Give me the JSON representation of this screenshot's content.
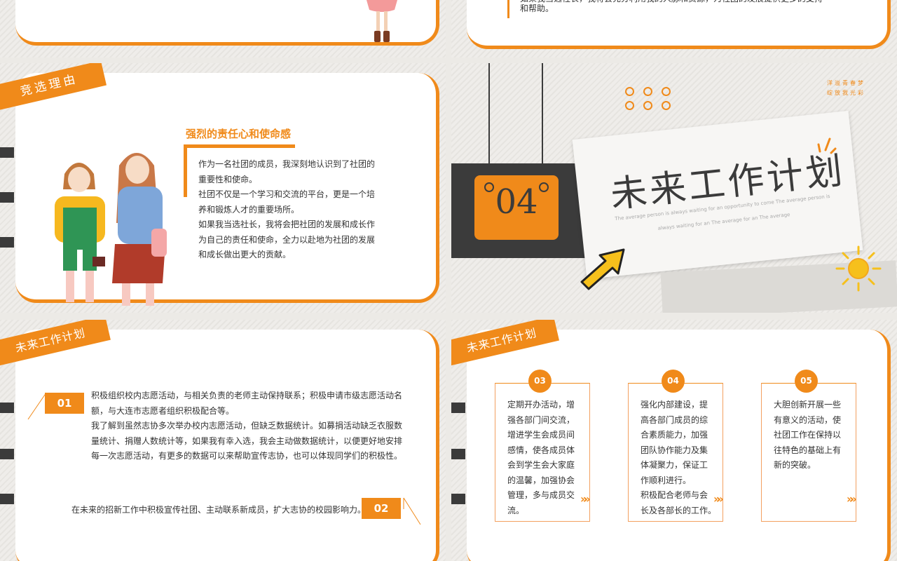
{
  "slide_tl": {
    "partial_text": ""
  },
  "slide_tr": {
    "partial_line1": "如果我当选社长，我将会充分利用我的人脉和资源，为社团的发展提供更多的支持",
    "partial_line2": "和帮助。"
  },
  "slide_ml": {
    "tag": "竞选理由",
    "heading": "强烈的责任心和使命感",
    "paragraphs": [
      "作为一名社团的成员，我深刻地认识到了社团的",
      "重要性和使命。",
      "社团不仅是一个学习和交流的平台，更是一个培",
      "养和锻炼人才的重要场所。",
      "如果我当选社长，我将会把社团的发展和成长作",
      "为自己的责任和使命，全力以赴地为社团的发展",
      "和成长做出更大的贡献。"
    ]
  },
  "slide_mr": {
    "badge_number": "04",
    "title": "未来工作计划",
    "subtitle_line1": "The average person is always waiting for an opportunity to come The average person is",
    "subtitle_line2": "always waiting for an The average for an The average",
    "corner_line1": "洋溢青春梦",
    "corner_line2": "绽放我光彩"
  },
  "slide_bl": {
    "tag": "未来工作计划",
    "item1_number": "01",
    "item1_lines": [
      "积极组织校内志愿活动，与相关负责的老师主动保持联系；积极申请市级志愿活动名",
      "额，与大连市志愿者组织积极配合等。",
      "我了解到虽然志协多次举办校内志愿活动，但缺乏数据统计。如募捐活动缺乏衣服数",
      "量统计、捐赠人数统计等，如果我有幸入选，我会主动做数据统计，以便更好地安排",
      "每一次志愿活动，有更多的数据可以来帮助宣传志协，也可以体现同学们的积极性。"
    ],
    "item2_text": "在未来的招新工作中积极宣传社团、主动联系新成员，扩大志协的校园影响力。",
    "item2_number": "02"
  },
  "slide_br": {
    "tag": "未来工作计划",
    "columns": [
      {
        "number": "03",
        "lines": [
          "定期开办活动，增",
          "强各部门间交流，",
          "增进学生会成员间",
          "感情，使各成员体",
          "会到学生会大家庭",
          "的温馨，加强协会",
          "管理，多与成员交",
          "流。"
        ]
      },
      {
        "number": "04",
        "lines": [
          "强化内部建设，提",
          "高各部门成员的综",
          "合素质能力，加强",
          "团队协作能力及集",
          "体凝聚力，保证工",
          "作顺利进行。",
          "积极配合老师与会",
          "长及各部长的工作。"
        ]
      },
      {
        "number": "05",
        "lines": [
          "大胆创新开展一些",
          "有意义的活动，使",
          "社团工作在保持以",
          "往特色的基础上有",
          "新的突破。"
        ]
      }
    ],
    "chevrons": "»»"
  },
  "colors": {
    "accent": "#f08a1a",
    "dark": "#3b3b3b",
    "text": "#333333"
  }
}
